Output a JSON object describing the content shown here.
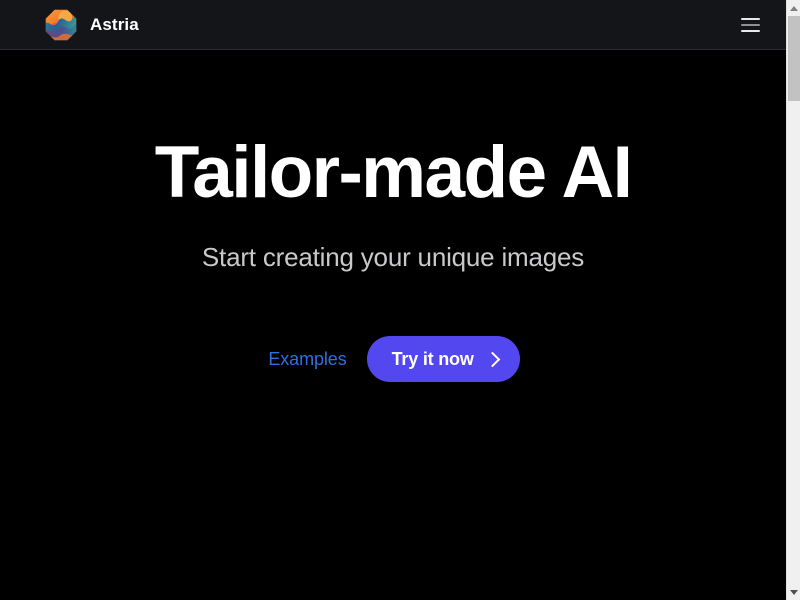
{
  "header": {
    "brand_name": "Astria",
    "logo_icon": "astria-hexagon-logo",
    "menu_icon": "hamburger-menu-icon",
    "background_color": "#141518"
  },
  "hero": {
    "title": "Tailor-made AI",
    "subtitle": "Start creating your unique images",
    "examples_link": "Examples",
    "cta_label": "Try it now",
    "cta_chevron_icon": "chevron-right-icon",
    "cta_color": "#5348ef",
    "link_color": "#2f6fe0",
    "background_color": "#000000"
  },
  "scrollbar": {
    "up_arrow_icon": "scroll-up-arrow-icon",
    "down_arrow_icon": "scroll-down-arrow-icon"
  }
}
